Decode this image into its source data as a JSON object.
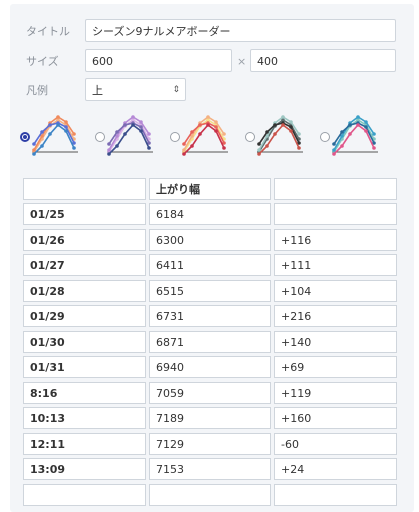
{
  "form": {
    "title_label": "タイトル",
    "title_value": "シーズン9ナルメアボーダー",
    "size_label": "サイズ",
    "width_value": "600",
    "times_sign": "×",
    "height_value": "400",
    "legend_label": "凡例",
    "legend_value": "上",
    "select_arrow": "⇕"
  },
  "themes": [
    {
      "name": "theme-1",
      "selected": true,
      "colors": [
        "#f4b183",
        "#f08a5d",
        "#5a6fd6",
        "#3d84c6"
      ]
    },
    {
      "name": "theme-2",
      "selected": false,
      "colors": [
        "#d9b3e6",
        "#b589d6",
        "#7a6bb3",
        "#3a4e8c"
      ]
    },
    {
      "name": "theme-3",
      "selected": false,
      "colors": [
        "#f7e08a",
        "#f4b183",
        "#e8615a",
        "#c8324a"
      ]
    },
    {
      "name": "theme-4",
      "selected": false,
      "colors": [
        "#5c6e6e",
        "#9ec7c3",
        "#333333",
        "#c9534a"
      ]
    },
    {
      "name": "theme-5",
      "selected": false,
      "colors": [
        "#7fc8c0",
        "#3aa0c8",
        "#2a6a9a",
        "#e0568a"
      ]
    }
  ],
  "table": {
    "headers": [
      "",
      "上がり幅",
      ""
    ],
    "rows": [
      [
        "01/25",
        "6184",
        ""
      ],
      [
        "01/26",
        "6300",
        "+116"
      ],
      [
        "01/27",
        "6411",
        "+111"
      ],
      [
        "01/28",
        "6515",
        "+104"
      ],
      [
        "01/29",
        "6731",
        "+216"
      ],
      [
        "01/30",
        "6871",
        "+140"
      ],
      [
        "01/31",
        "6940",
        "+69"
      ],
      [
        "8:16",
        "7059",
        "+119"
      ],
      [
        "10:13",
        "7189",
        "+160"
      ],
      [
        "12:11",
        "7129",
        "-60"
      ],
      [
        "13:09",
        "7153",
        "+24"
      ],
      [
        "",
        "",
        ""
      ]
    ]
  }
}
